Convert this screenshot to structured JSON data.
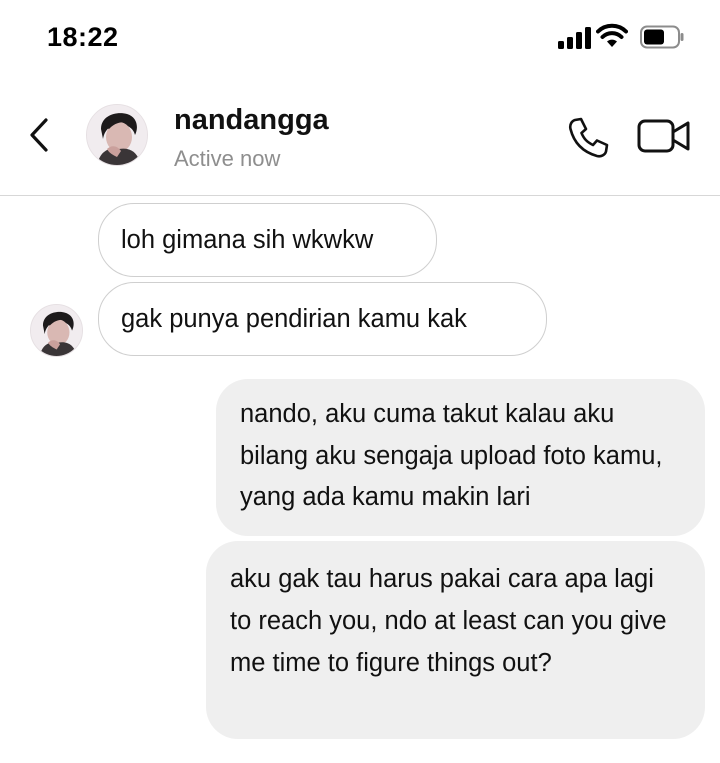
{
  "status_bar": {
    "time": "18:22"
  },
  "header": {
    "name": "nandangga",
    "status": "Active now"
  },
  "icons": {
    "back": "chevron-left-icon",
    "call": "phone-icon",
    "video": "video-camera-icon",
    "signal": "cellular-signal-icon",
    "wifi": "wifi-icon",
    "battery": "battery-icon"
  },
  "colors": {
    "outgoing_bubble": "#efefef",
    "incoming_border": "#cfcfcf",
    "secondary_text": "#8e8e8e"
  },
  "messages": [
    {
      "direction": "incoming",
      "text": "loh gimana sih wkwkw"
    },
    {
      "direction": "incoming",
      "text": "gak punya pendirian kamu kak"
    },
    {
      "direction": "outgoing",
      "text": "nando, aku cuma takut kalau aku bilang aku sengaja upload foto kamu, yang ada kamu makin lari"
    },
    {
      "direction": "outgoing",
      "text": "aku gak tau harus pakai cara apa lagi to reach you, ndo at least can you give me time to figure things out?"
    }
  ]
}
